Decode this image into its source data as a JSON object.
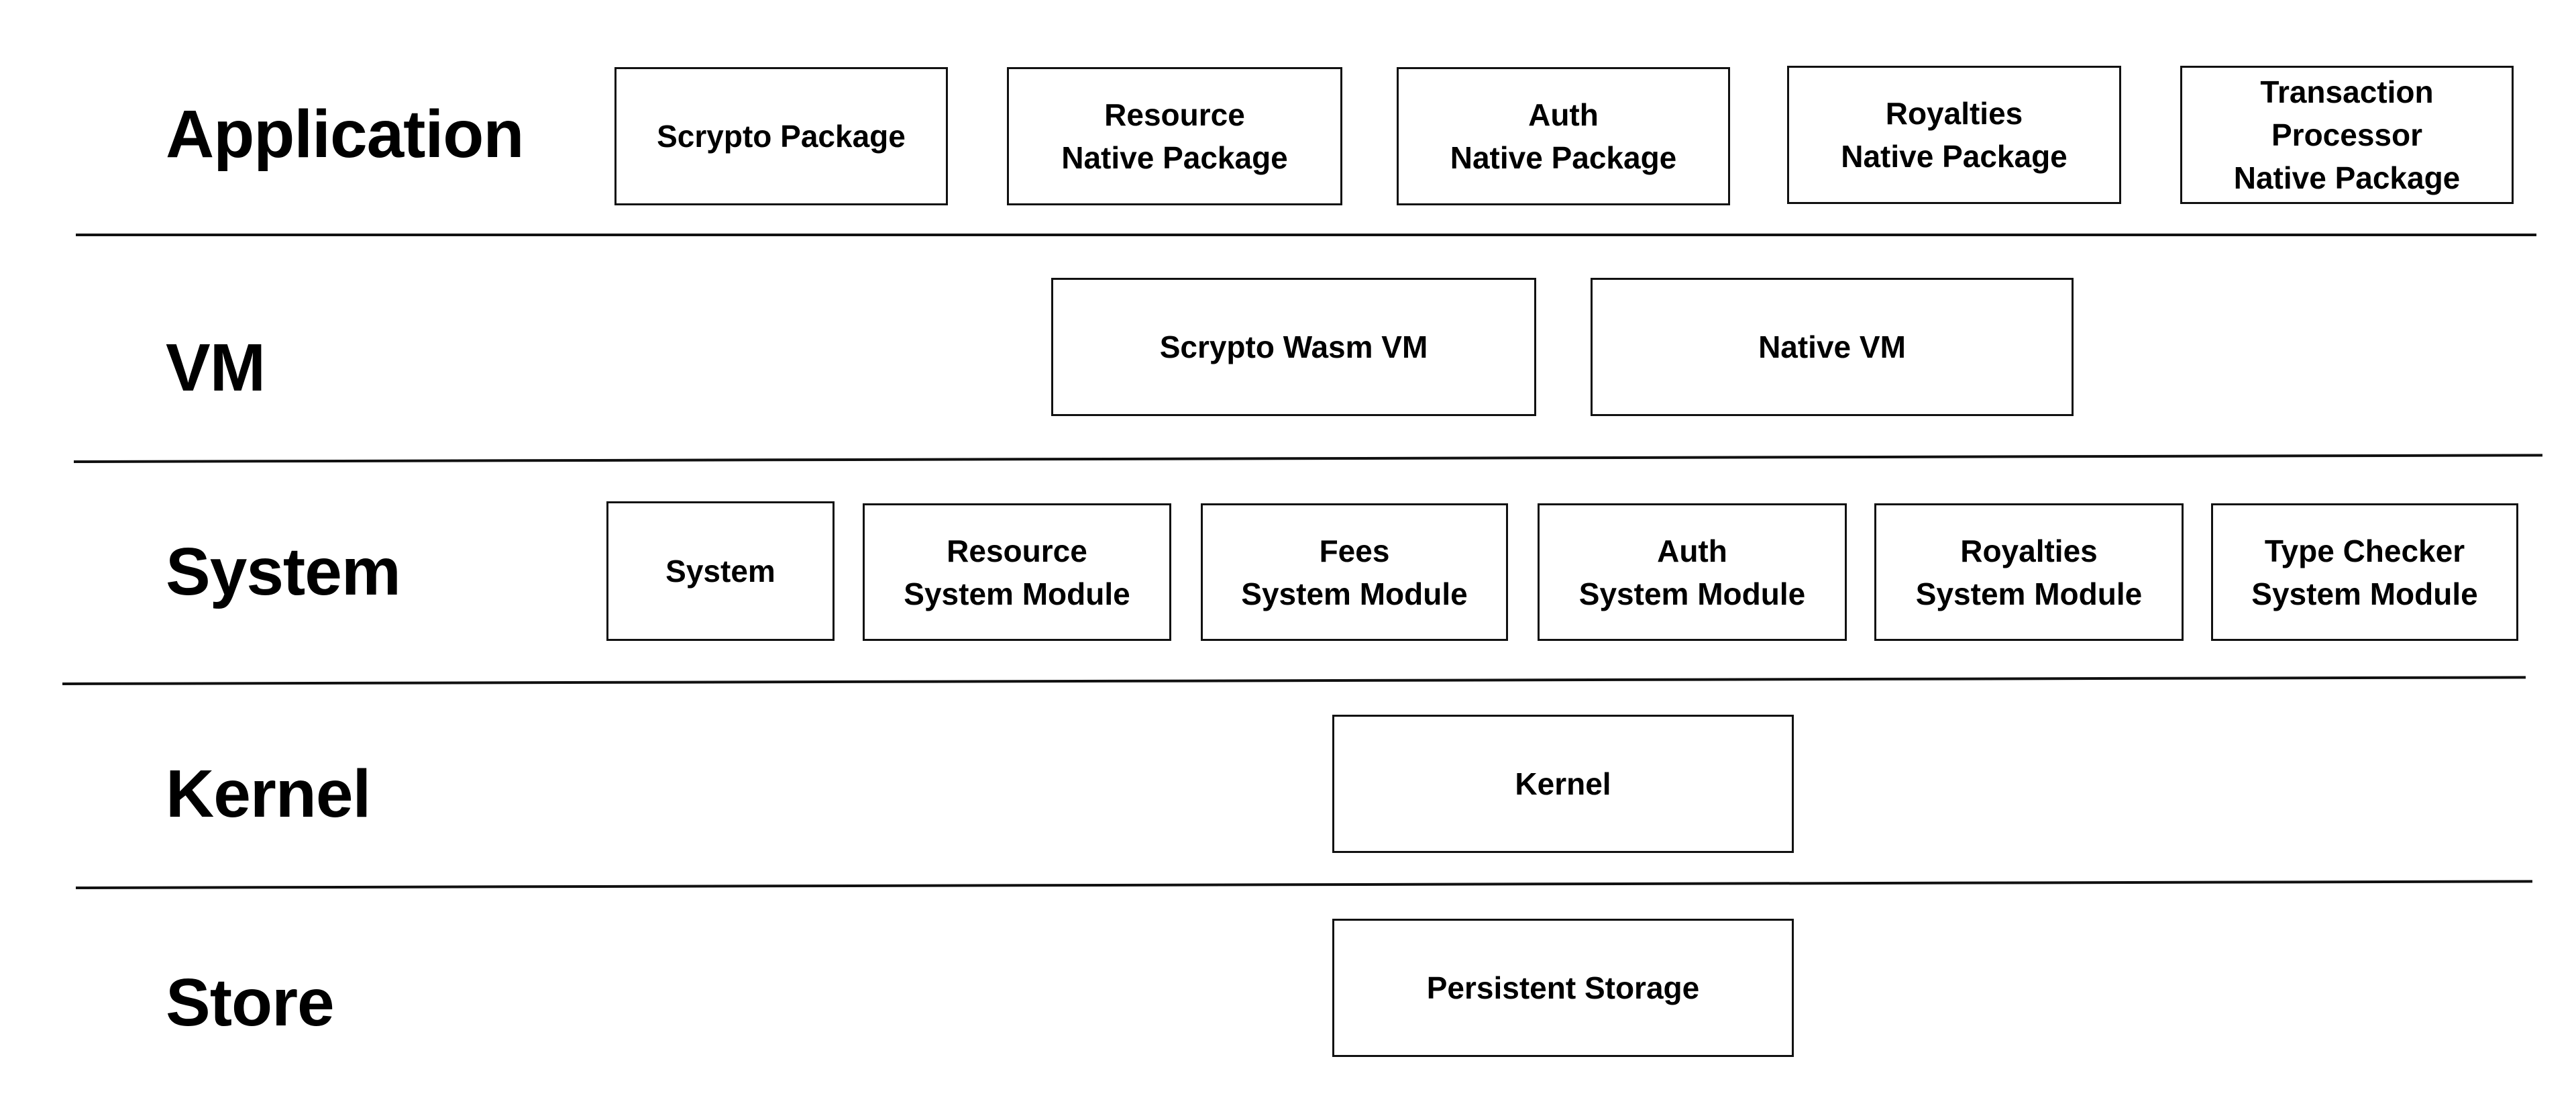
{
  "layers": [
    {
      "label": "Application",
      "components": [
        "Scrypto Package",
        "Resource\nNative Package",
        "Auth\nNative Package",
        "Royalties\nNative Package",
        "Transaction\nProcessor\nNative Package"
      ]
    },
    {
      "label": "VM",
      "components": [
        "Scrypto Wasm VM",
        "Native VM"
      ]
    },
    {
      "label": "System",
      "components": [
        "System",
        "Resource\nSystem Module",
        "Fees\nSystem Module",
        "Auth\nSystem Module",
        "Royalties\nSystem Module",
        "Type Checker\nSystem Module"
      ]
    },
    {
      "label": "Kernel",
      "components": [
        "Kernel"
      ]
    },
    {
      "label": "Store",
      "components": [
        "Persistent Storage"
      ]
    }
  ]
}
